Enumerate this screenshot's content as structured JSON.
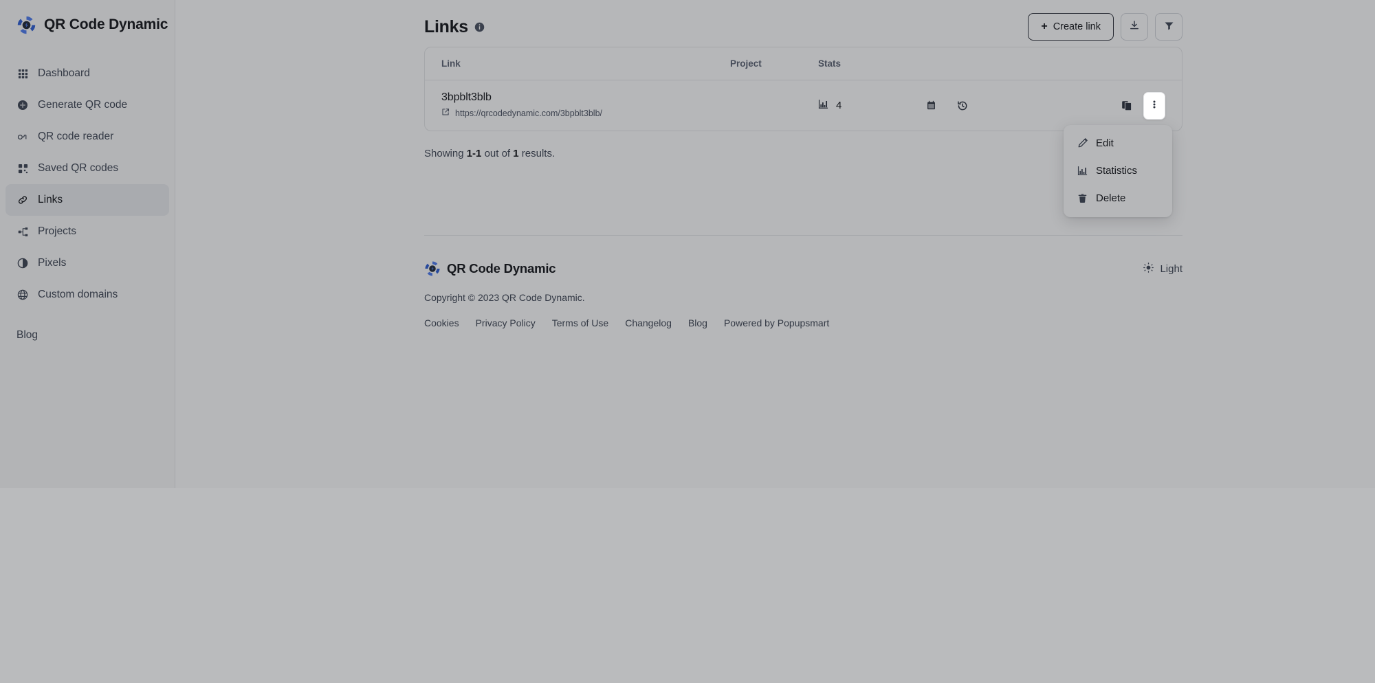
{
  "brand": {
    "name": "QR Code Dynamic",
    "logo_icon": "qr-code-dynamic-logo"
  },
  "sidebar": {
    "items": [
      {
        "label": "Dashboard",
        "icon": "grid-icon",
        "active": false
      },
      {
        "label": "Generate QR code",
        "icon": "plus-circle-icon",
        "active": false
      },
      {
        "label": "QR code reader",
        "icon": "scan-icon",
        "active": false
      },
      {
        "label": "Saved QR codes",
        "icon": "squares-icon",
        "active": false
      },
      {
        "label": "Links",
        "icon": "link-icon",
        "active": true
      },
      {
        "label": "Projects",
        "icon": "sitemap-icon",
        "active": false
      },
      {
        "label": "Pixels",
        "icon": "half-circle-icon",
        "active": false
      },
      {
        "label": "Custom domains",
        "icon": "globe-icon",
        "active": false
      }
    ],
    "secondary_items": [
      {
        "label": "Blog",
        "icon": "",
        "active": false
      }
    ]
  },
  "header": {
    "title": "Links",
    "info_icon": "info-icon",
    "create_button": {
      "label": "Create link",
      "icon": "plus-icon"
    },
    "download_button": {
      "label": "",
      "icon": "download-icon"
    },
    "filter_button": {
      "label": "",
      "icon": "filter-icon"
    }
  },
  "table": {
    "columns": [
      "Link",
      "Project",
      "Stats"
    ],
    "rows": [
      {
        "name": "3bpblt3blb",
        "url": "https://qrcodedynamic.com/3bpblt3blb/",
        "url_icon": "external-link-icon",
        "project": "",
        "clicks": "4",
        "clicks_icon": "bar-chart-icon",
        "calendar_icon": "calendar-icon",
        "history_icon": "history-icon",
        "copy_icon": "copy-icon",
        "menu_icon": "kebab-menu-icon"
      }
    ]
  },
  "row_menu": {
    "open": true,
    "items": [
      {
        "label": "Edit",
        "icon": "pencil-icon",
        "hovered": true
      },
      {
        "label": "Statistics",
        "icon": "bar-chart-icon",
        "hovered": false
      },
      {
        "label": "Delete",
        "icon": "trash-icon",
        "hovered": false
      }
    ]
  },
  "results": {
    "prefix": "Showing ",
    "range": "1-1",
    "middle": " out of ",
    "total": "1",
    "suffix": " results."
  },
  "footer": {
    "brand_name": "QR Code Dynamic",
    "copyright": "Copyright © 2023 QR Code Dynamic.",
    "theme": {
      "label": "Light",
      "icon": "sun-icon"
    },
    "links": [
      "Cookies",
      "Privacy Policy",
      "Terms of Use",
      "Changelog",
      "Blog",
      "Powered by Popupsmart"
    ]
  },
  "colors": {
    "brand_blue": "#3b6ce3",
    "text_primary": "#14161a",
    "text_secondary": "#3f4654",
    "border": "#e6e7e9",
    "active_nav_bg": "#eceef1",
    "overlay": "rgba(27,30,37,0.32)"
  }
}
